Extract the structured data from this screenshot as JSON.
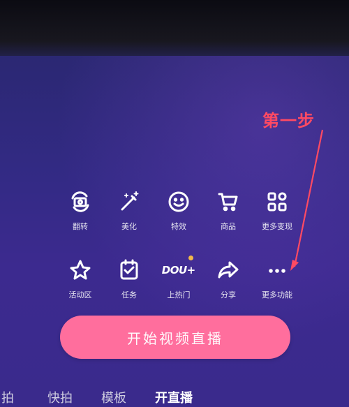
{
  "annotation": {
    "text": "第一步",
    "color": "#ff4a63"
  },
  "toolbar_row1": [
    {
      "label": "翻转",
      "icon": "flip-camera-icon"
    },
    {
      "label": "美化",
      "icon": "magic-wand-icon"
    },
    {
      "label": "特效",
      "icon": "smiley-icon"
    },
    {
      "label": "商品",
      "icon": "shopping-cart-icon"
    },
    {
      "label": "更多变现",
      "icon": "grid-apps-icon"
    }
  ],
  "toolbar_row2": [
    {
      "label": "活动区",
      "icon": "star-icon"
    },
    {
      "label": "任务",
      "icon": "task-checklist-icon"
    },
    {
      "label": "上热门",
      "icon": "dou-plus-icon",
      "icon_text": "DOU"
    },
    {
      "label": "分享",
      "icon": "share-arrow-icon"
    },
    {
      "label": "更多功能",
      "icon": "more-dots-icon"
    }
  ],
  "cta": {
    "label": "开始视频直播",
    "color": "#ff6e9d"
  },
  "bottom_tabs": [
    {
      "label": "拍",
      "active": false
    },
    {
      "label": "快拍",
      "active": false
    },
    {
      "label": "模板",
      "active": false
    },
    {
      "label": "开直播",
      "active": true
    }
  ],
  "accent": {
    "badge": "#f2b84a"
  }
}
